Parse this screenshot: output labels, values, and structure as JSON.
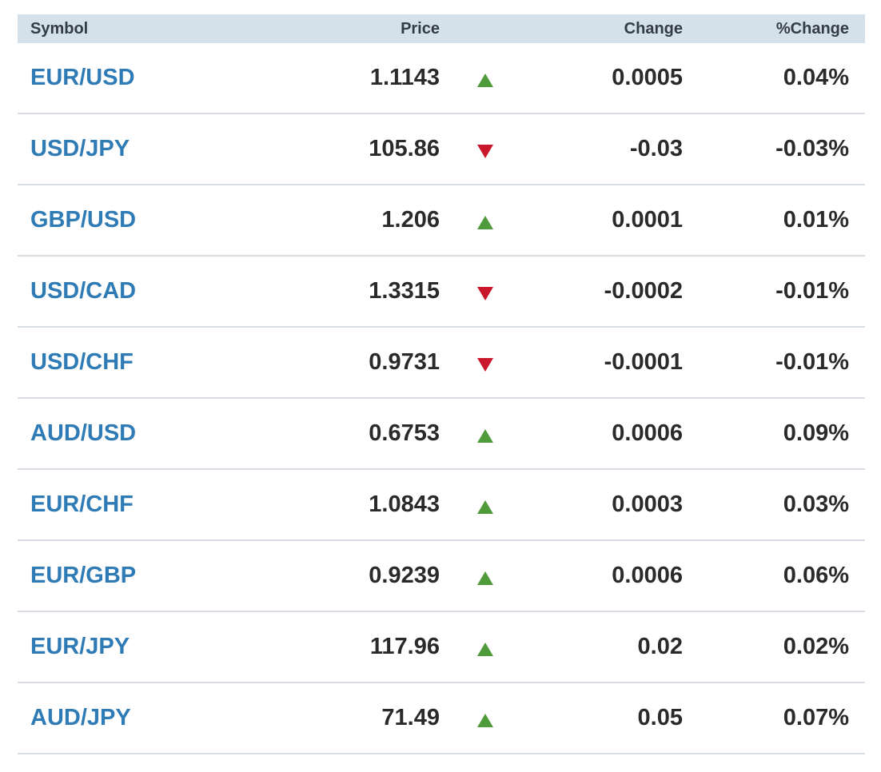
{
  "table": {
    "headers": {
      "symbol": "Symbol",
      "price": "Price",
      "change": "Change",
      "pct_change": "%Change"
    },
    "colors": {
      "up": "#4f9a3a",
      "down": "#c9182b",
      "symbol": "#2f7bb6",
      "header_bg": "#d4e1ea"
    },
    "rows": [
      {
        "symbol": "EUR/USD",
        "price": "1.1143",
        "direction": "up",
        "change": "0.0005",
        "pct_change": "0.04%"
      },
      {
        "symbol": "USD/JPY",
        "price": "105.86",
        "direction": "down",
        "change": "-0.03",
        "pct_change": "-0.03%"
      },
      {
        "symbol": "GBP/USD",
        "price": "1.206",
        "direction": "up",
        "change": "0.0001",
        "pct_change": "0.01%"
      },
      {
        "symbol": "USD/CAD",
        "price": "1.3315",
        "direction": "down",
        "change": "-0.0002",
        "pct_change": "-0.01%"
      },
      {
        "symbol": "USD/CHF",
        "price": "0.9731",
        "direction": "down",
        "change": "-0.0001",
        "pct_change": "-0.01%"
      },
      {
        "symbol": "AUD/USD",
        "price": "0.6753",
        "direction": "up",
        "change": "0.0006",
        "pct_change": "0.09%"
      },
      {
        "symbol": "EUR/CHF",
        "price": "1.0843",
        "direction": "up",
        "change": "0.0003",
        "pct_change": "0.03%"
      },
      {
        "symbol": "EUR/GBP",
        "price": "0.9239",
        "direction": "up",
        "change": "0.0006",
        "pct_change": "0.06%"
      },
      {
        "symbol": "EUR/JPY",
        "price": "117.96",
        "direction": "up",
        "change": "0.02",
        "pct_change": "0.02%"
      },
      {
        "symbol": "AUD/JPY",
        "price": "71.49",
        "direction": "up",
        "change": "0.05",
        "pct_change": "0.07%"
      }
    ]
  }
}
